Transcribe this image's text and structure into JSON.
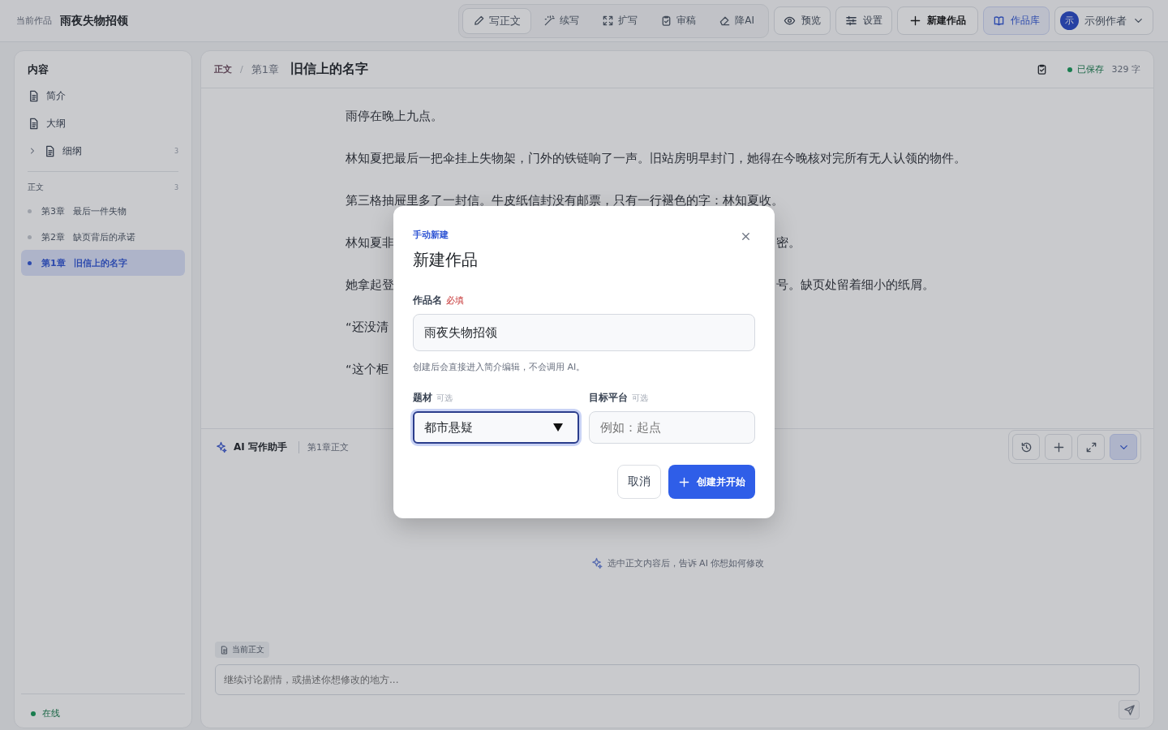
{
  "header": {
    "label": "当前作品",
    "title": "雨夜失物招领"
  },
  "toolbar": [
    {
      "label": "写正文",
      "selected": true
    },
    {
      "label": "续写",
      "selected": false
    },
    {
      "label": "扩写",
      "selected": false
    },
    {
      "label": "审稿",
      "selected": false
    },
    {
      "label": "降AI",
      "selected": false
    }
  ],
  "actions": [
    {
      "label": "预览",
      "kind": "plain"
    },
    {
      "label": "设置",
      "kind": "plain"
    },
    {
      "label": "新建作品",
      "kind": "strong"
    },
    {
      "label": "作品库",
      "kind": "accent"
    }
  ],
  "user": {
    "avatar": "示",
    "name": "示例作者"
  },
  "sidebar": {
    "title": "内容",
    "items": [
      {
        "label": "简介"
      },
      {
        "label": "大纲"
      },
      {
        "label": "细纲",
        "count": "3",
        "expanded": false
      }
    ],
    "section": {
      "title": "正文",
      "count": "3",
      "chapters": [
        {
          "number": "第3章",
          "title": "最后一件失物",
          "selected": false
        },
        {
          "number": "第2章",
          "title": "缺页背后的承诺",
          "selected": false
        },
        {
          "number": "第1章",
          "title": "旧信上的名字",
          "selected": true
        }
      ]
    },
    "status": "在线"
  },
  "editor": {
    "breadcrumb": [
      "正文",
      "第1章"
    ],
    "separator": "/",
    "title": "旧信上的名字",
    "saved": "已保存",
    "word_count": "329 字",
    "paragraphs": [
      {
        "parts": [
          "雨停在晚上九点。"
        ]
      },
      {
        "parts": [
          "林知夏把最后一把伞挂上失物架，门外的铁链响了一声。旧站房明早封门，她得在今晚核对完所有无人认领的物件。"
        ]
      },
      {
        "parts": [
          "第三格抽屉里多了一封信。牛皮纸信封没有邮票，只有一行褪色的字：林知夏收。"
        ]
      },
      {
        "parts": [
          "林知夏非",
          "密。"
        ]
      },
      {
        "parts": [
          "她拿起登",
          "号。缺页处留着细小的纸屑。"
        ]
      },
      {
        "parts": [
          "“还没清"
        ]
      },
      {
        "parts": [
          "“这个柜"
        ]
      }
    ]
  },
  "assistant": {
    "title": "AI 写作助手",
    "context": "第1章正文",
    "hint": "选中正文内容后，告诉 AI 你想如何修改",
    "chip": "当前正文",
    "input": {
      "placeholder": "继续讨论剧情，或描述你想修改的地方..."
    }
  },
  "modal": {
    "eyebrow": "手动新建",
    "title": "新建作品",
    "name_field": {
      "label": "作品名",
      "tag": "必填",
      "value": "雨夜失物招领",
      "help": "创建后会直接进入简介编辑，不会调用 AI。"
    },
    "genre_field": {
      "label": "题材",
      "tag": "可选",
      "value": "都市悬疑"
    },
    "platform_field": {
      "label": "目标平台",
      "tag": "可选",
      "placeholder": "例如：起点"
    },
    "cancel": "取消",
    "submit": "创建并开始"
  }
}
